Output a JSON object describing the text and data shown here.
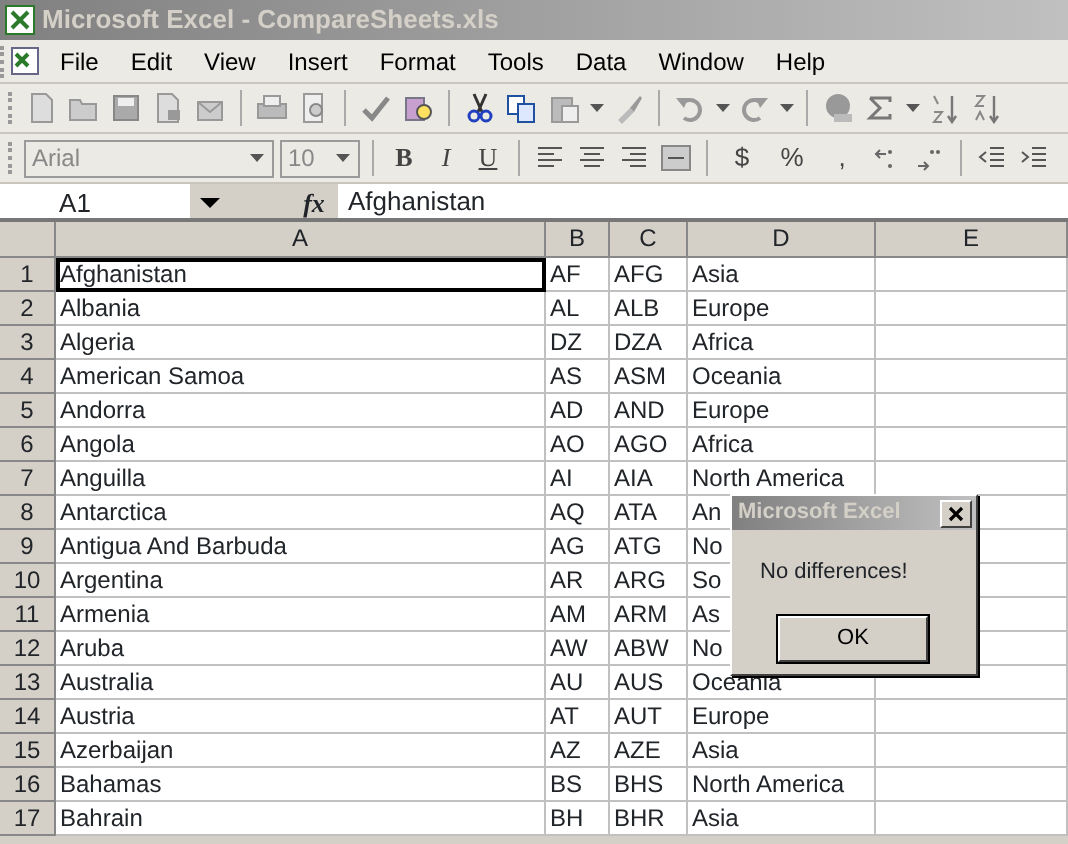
{
  "window": {
    "title": "Microsoft Excel - CompareSheets.xls"
  },
  "menu": [
    "File",
    "Edit",
    "View",
    "Insert",
    "Format",
    "Tools",
    "Data",
    "Window",
    "Help"
  ],
  "formatting_toolbar": {
    "font": "Arial",
    "size": "10",
    "style_buttons": [
      "B",
      "I",
      "U"
    ],
    "number_buttons": [
      "$",
      "%",
      ","
    ]
  },
  "formula_bar": {
    "name_box": "A1",
    "fx": "fx",
    "content": "Afghanistan"
  },
  "columns": [
    "A",
    "B",
    "C",
    "D",
    "E"
  ],
  "rows": [
    {
      "number": "1",
      "cells": [
        "Afghanistan",
        "AF",
        "AFG",
        "Asia"
      ]
    },
    {
      "number": "2",
      "cells": [
        "Albania",
        "AL",
        "ALB",
        "Europe"
      ]
    },
    {
      "number": "3",
      "cells": [
        "Algeria",
        "DZ",
        "DZA",
        "Africa"
      ]
    },
    {
      "number": "4",
      "cells": [
        "American Samoa",
        "AS",
        "ASM",
        "Oceania"
      ]
    },
    {
      "number": "5",
      "cells": [
        "Andorra",
        "AD",
        "AND",
        "Europe"
      ]
    },
    {
      "number": "6",
      "cells": [
        "Angola",
        "AO",
        "AGO",
        "Africa"
      ]
    },
    {
      "number": "7",
      "cells": [
        "Anguilla",
        "AI",
        "AIA",
        "North America"
      ]
    },
    {
      "number": "8",
      "cells": [
        "Antarctica",
        "AQ",
        "ATA",
        "An"
      ]
    },
    {
      "number": "9",
      "cells": [
        "Antigua And Barbuda",
        "AG",
        "ATG",
        "No"
      ]
    },
    {
      "number": "10",
      "cells": [
        "Argentina",
        "AR",
        "ARG",
        "So"
      ]
    },
    {
      "number": "11",
      "cells": [
        "Armenia",
        "AM",
        "ARM",
        "As"
      ]
    },
    {
      "number": "12",
      "cells": [
        "Aruba",
        "AW",
        "ABW",
        "No"
      ]
    },
    {
      "number": "13",
      "cells": [
        "Australia",
        "AU",
        "AUS",
        "Oceania"
      ]
    },
    {
      "number": "14",
      "cells": [
        "Austria",
        "AT",
        "AUT",
        "Europe"
      ]
    },
    {
      "number": "15",
      "cells": [
        "Azerbaijan",
        "AZ",
        "AZE",
        "Asia"
      ]
    },
    {
      "number": "16",
      "cells": [
        "Bahamas",
        "BS",
        "BHS",
        "North America"
      ]
    },
    {
      "number": "17",
      "cells": [
        "Bahrain",
        "BH",
        "BHR",
        "Asia"
      ]
    }
  ],
  "dialog": {
    "title": "Microsoft Excel",
    "message": "No differences!",
    "button": "OK"
  }
}
